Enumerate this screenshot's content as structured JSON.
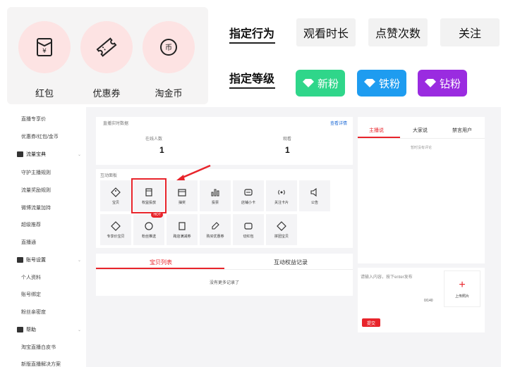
{
  "rewards": [
    {
      "label": "红包",
      "icon": "red-envelope-icon"
    },
    {
      "label": "优惠券",
      "icon": "coupon-icon"
    },
    {
      "label": "淘金币",
      "icon": "coin-icon"
    }
  ],
  "behavior": {
    "title": "指定行为",
    "options": [
      "观看时长",
      "点赞次数",
      "关注"
    ]
  },
  "level": {
    "title": "指定等级",
    "options": [
      {
        "label": "新粉",
        "color": "#2fd68a"
      },
      {
        "label": "铁粉",
        "color": "#1e9cf0"
      },
      {
        "label": "钻粉",
        "color": "#9a2be0"
      }
    ]
  },
  "sidebar": {
    "items": [
      {
        "label": "直播专享价",
        "type": "item"
      },
      {
        "label": "优惠券/红包/金币",
        "type": "item"
      },
      {
        "label": "流量宝典",
        "type": "head"
      },
      {
        "label": "守护主播规则",
        "type": "item"
      },
      {
        "label": "流量奖励规则",
        "type": "item"
      },
      {
        "label": "微博流量加持",
        "type": "item"
      },
      {
        "label": "超级推荐",
        "type": "item"
      },
      {
        "label": "直播通",
        "type": "item"
      },
      {
        "label": "账号设置",
        "type": "head"
      },
      {
        "label": "个人资料",
        "type": "item"
      },
      {
        "label": "账号绑定",
        "type": "item"
      },
      {
        "label": "粉丝亲密度",
        "type": "item"
      },
      {
        "label": "帮助",
        "type": "head"
      },
      {
        "label": "淘宝直播白皮书",
        "type": "item"
      },
      {
        "label": "新版直播解决方案",
        "type": "item"
      }
    ]
  },
  "realtime": {
    "title": "直播实时数据",
    "link": "查看详情",
    "online_label": "在线人数",
    "online_value": "1",
    "view_label": "观看",
    "view_value": "1"
  },
  "interact": {
    "title": "互动面板",
    "row1": [
      "宝贝",
      "权益投放",
      "抽奖",
      "投票",
      "店铺小卡",
      "关注卡片",
      "公告"
    ],
    "row2": [
      "专享价宝贝",
      "粉丝推送",
      "跨店满减券",
      "购买优惠券",
      "切红包",
      "拼团宝贝"
    ],
    "hot": "HOT"
  },
  "list_tabs": {
    "items": "宝贝列表",
    "records": "互动权益记录",
    "empty": "没有更多记录了"
  },
  "chat": {
    "tabs": [
      "主播说",
      "大家说",
      "禁言用户"
    ],
    "empty": "暂时没有评论",
    "placeholder": "请输入内容，按下enter发布",
    "counter": "0/140",
    "upload": "上传照片",
    "submit": "提交"
  }
}
